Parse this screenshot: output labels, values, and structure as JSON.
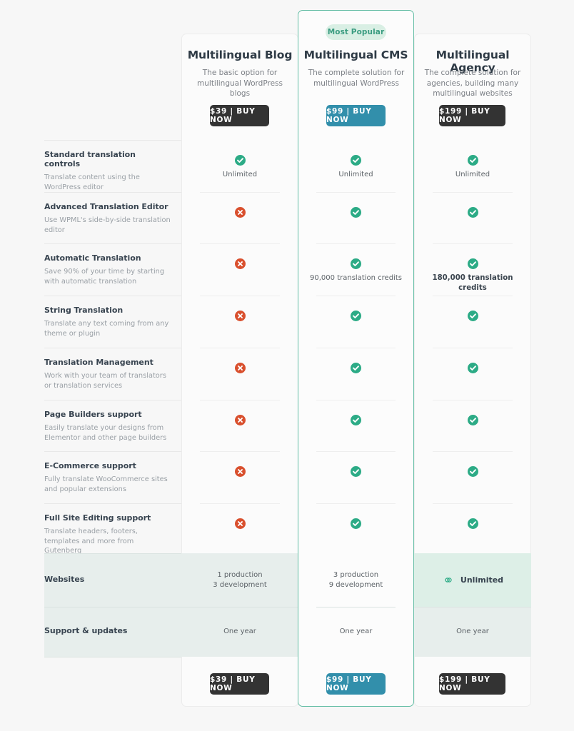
{
  "page": {
    "background": "#f7f7f7",
    "accent_teal": "#63bda4",
    "check_color": "#2cab86",
    "cross_color": "#d9502e",
    "cta_dark": "#333333",
    "cta_teal": "#328fab",
    "highlight_band": "#e7eeec",
    "agency_highlight": "#ddefe7"
  },
  "plans": [
    {
      "id": "blog",
      "name": "Multilingual Blog",
      "description": "The basic option for multilingual WordPress blogs",
      "cta_label": "$39 | BUY NOW",
      "cta_style": "dark",
      "most_popular": false,
      "badge_label": ""
    },
    {
      "id": "cms",
      "name": "Multilingual CMS",
      "description": "The complete solution for multilingual WordPress",
      "cta_label": "$99 | BUY NOW",
      "cta_style": "teal",
      "most_popular": true,
      "badge_label": "Most Popular"
    },
    {
      "id": "agency",
      "name": "Multilingual Agency",
      "description": "The complete solution for agencies, building many multilingual websites",
      "cta_label": "$199 | BUY NOW",
      "cta_style": "dark",
      "most_popular": false,
      "badge_label": ""
    }
  ],
  "features": [
    {
      "title": "Standard translation controls",
      "desc": "Translate content using the WordPress editor",
      "cells": [
        {
          "icon": "check",
          "text": "Unlimited"
        },
        {
          "icon": "check",
          "text": "Unlimited"
        },
        {
          "icon": "check",
          "text": "Unlimited"
        }
      ]
    },
    {
      "title": "Advanced Translation Editor",
      "desc": "Use WPML's side-by-side translation editor",
      "cells": [
        {
          "icon": "cross",
          "text": ""
        },
        {
          "icon": "check",
          "text": ""
        },
        {
          "icon": "check",
          "text": ""
        }
      ]
    },
    {
      "title": "Automatic Translation",
      "desc": "Save 90% of your time by starting with automatic translation",
      "cells": [
        {
          "icon": "cross",
          "text": ""
        },
        {
          "icon": "check",
          "text": "90,000 translation credits"
        },
        {
          "icon": "check",
          "text": "180,000 translation credits",
          "bold": true
        }
      ]
    },
    {
      "title": "String Translation",
      "desc": "Translate any text coming from any theme or plugin",
      "cells": [
        {
          "icon": "cross",
          "text": ""
        },
        {
          "icon": "check",
          "text": ""
        },
        {
          "icon": "check",
          "text": ""
        }
      ]
    },
    {
      "title": "Translation Management",
      "desc": "Work with your team of translators or translation services",
      "cells": [
        {
          "icon": "cross",
          "text": ""
        },
        {
          "icon": "check",
          "text": ""
        },
        {
          "icon": "check",
          "text": ""
        }
      ]
    },
    {
      "title": "Page Builders support",
      "desc": "Easily translate your designs from Elementor and other page builders",
      "cells": [
        {
          "icon": "cross",
          "text": ""
        },
        {
          "icon": "check",
          "text": ""
        },
        {
          "icon": "check",
          "text": ""
        }
      ]
    },
    {
      "title": "E-Commerce support",
      "desc": "Fully translate WooCommerce sites and popular extensions",
      "cells": [
        {
          "icon": "cross",
          "text": ""
        },
        {
          "icon": "check",
          "text": ""
        },
        {
          "icon": "check",
          "text": ""
        }
      ]
    },
    {
      "title": "Full Site Editing support",
      "desc": "Translate headers, footers, templates and more from Gutenberg",
      "cells": [
        {
          "icon": "cross",
          "text": ""
        },
        {
          "icon": "check",
          "text": ""
        },
        {
          "icon": "check",
          "text": ""
        }
      ]
    }
  ],
  "summary_rows": [
    {
      "title": "Websites",
      "cells": [
        {
          "icon": "none",
          "text": "1 production\n3 development"
        },
        {
          "icon": "none",
          "text": "3 production\n9 development"
        },
        {
          "icon": "infinity",
          "text": "Unlimited"
        }
      ]
    },
    {
      "title": "Support & updates",
      "cells": [
        {
          "icon": "none",
          "text": "One year"
        },
        {
          "icon": "none",
          "text": "One year"
        },
        {
          "icon": "none",
          "text": "One year"
        }
      ]
    }
  ]
}
